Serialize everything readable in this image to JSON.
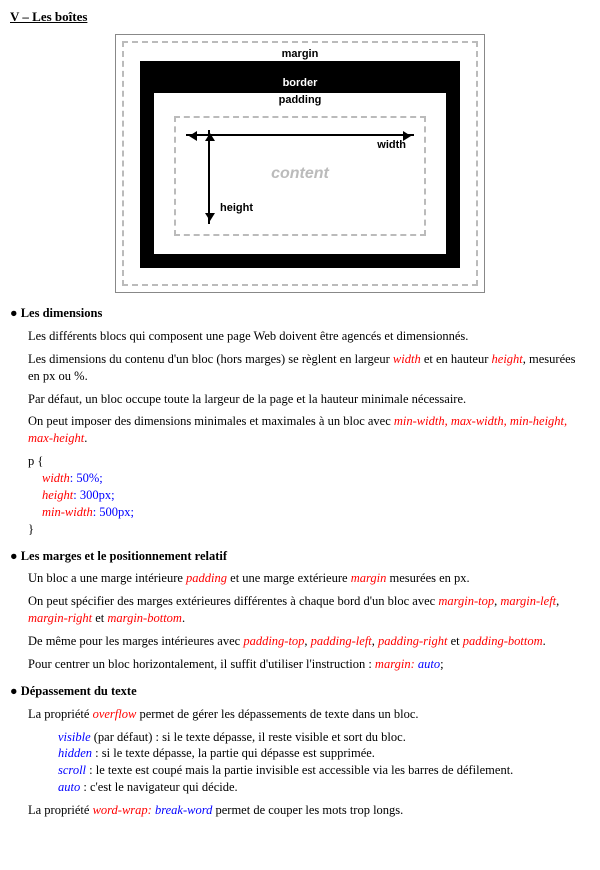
{
  "title": "V – Les boîtes",
  "diagram": {
    "margin": "margin",
    "border": "border",
    "padding": "padding",
    "content": "content",
    "width": "width",
    "height": "height"
  },
  "sec1": {
    "title": "Les dimensions",
    "p1": "Les différents blocs qui composent une page Web doivent être agencés et dimensionnés.",
    "p2a": "Les dimensions du contenu d'un bloc (hors marges) se règlent en largeur ",
    "p2b": " et en hauteur ",
    "p2c": ", mesurées en px ou %.",
    "kw_width": "width",
    "kw_height": "height",
    "p3": "Par défaut, un bloc occupe toute la largeur de la page et la hauteur minimale nécessaire.",
    "p4a": "On peut imposer des dimensions minimales et maximales à un bloc avec ",
    "kw_minmax": "min-width, max-width, min-height, max-height",
    "p4c": ".",
    "code": {
      "open": "p {",
      "l1p": "width",
      "l1v": ": 50%;",
      "l2p": "height",
      "l2v": ": 300px;",
      "l3p": "min-width",
      "l3v": ": 500px;",
      "close": "}"
    }
  },
  "sec2": {
    "title": "Les marges et le positionnement relatif",
    "p1a": "Un bloc a une marge intérieure ",
    "kw_padding": "padding",
    "p1b": " et une marge extérieure ",
    "kw_margin": "margin",
    "p1c": " mesurées en px.",
    "p2a": "On peut spécifier des marges extérieures différentes à chaque bord d'un bloc avec ",
    "kw_mt": "margin-top",
    "kw_ml": "margin-left",
    "kw_mr": "margin-right",
    "kw_mb": "margin-bottom",
    "sep": ", ",
    "and": " et ",
    "dot": ".",
    "p3a": "De même pour les marges intérieures avec ",
    "kw_pt": "padding-top",
    "kw_pl": "padding-left",
    "kw_pr": "padding-right",
    "kw_pb": "padding-bottom",
    "p4a": "Pour centrer un bloc horizontalement, il suffit d'utiliser l'instruction : ",
    "kw_marginlbl": "margin: ",
    "kw_auto": "auto",
    "semi": ";"
  },
  "sec3": {
    "title": "Dépassement du texte",
    "p1a": "La propriété ",
    "kw_overflow": "overflow",
    "p1b": " permet de gérer les dépassements de texte dans un bloc.",
    "visible_k": "visible",
    "visible_t": " (par défaut) : si le texte dépasse, il reste visible et sort du bloc.",
    "hidden_k": "hidden",
    "hidden_t": " : si le texte dépasse, la partie qui dépasse est supprimée.",
    "scroll_k": "scroll",
    "scroll_t": " : le texte est coupé mais la partie invisible est accessible via les barres de défilement.",
    "auto_k": "auto",
    "auto_t": " : c'est le navigateur qui décide.",
    "p2a": "La propriété ",
    "kw_wordwrap": "word-wrap: ",
    "kw_break": "break-word",
    "p2b": " permet de couper les mots trop longs."
  }
}
